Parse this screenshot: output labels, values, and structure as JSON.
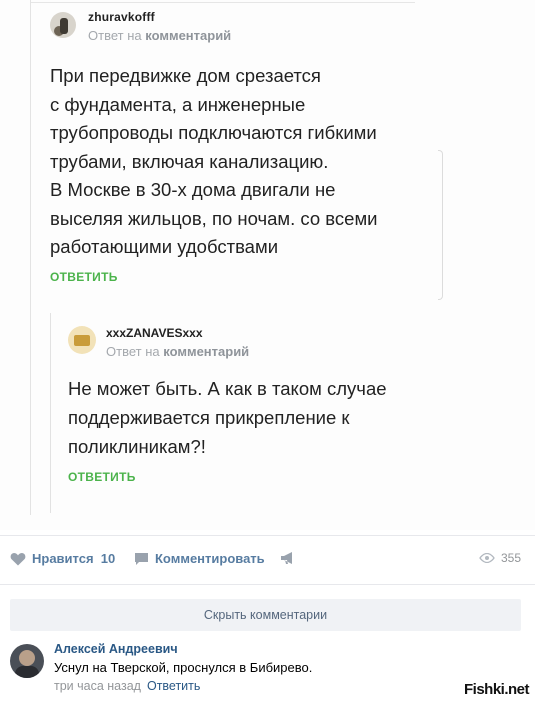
{
  "screenshot": {
    "comment1": {
      "author": "zhuravkofff",
      "reply_prefix": "Ответ на",
      "reply_target": "комментарий",
      "text_lines": [
        "При передвижке дом срезается",
        "с фундамента, а инженерные",
        "трубопроводы подключаются гибкими",
        "трубами, включая канализацию.",
        "В Москве в 30-х дома двигали не",
        "выселяя жильцов, по ночам. со всеми",
        "работающими удобствами"
      ],
      "reply_label": "ОТВЕТИТЬ"
    },
    "comment2": {
      "author": "xxxZANAVESxxx",
      "reply_prefix": "Ответ на",
      "reply_target": "комментарий",
      "text_lines": [
        "Не может быть. А как в таком случае",
        "поддерживается прикрепление к",
        "поликлиникам?!"
      ],
      "reply_label": "ОТВЕТИТЬ"
    }
  },
  "post_actions": {
    "like_label": "Нравится",
    "like_count": "10",
    "comment_label": "Комментировать",
    "views": "355"
  },
  "hide_comments_label": "Скрыть комментарии",
  "comment": {
    "author": "Алексей Андреевич",
    "text": "Уснул на Тверской, проснулся в Бибирево.",
    "time": "три часа назад",
    "reply_label": "Ответить"
  },
  "watermark": "Fishki.net",
  "colors": {
    "reply_green": "#4bb34b",
    "vk_link": "#2a5885",
    "action_blue": "#577ca1"
  },
  "icons": [
    "heart-icon",
    "comment-icon",
    "megaphone-icon",
    "eye-icon"
  ]
}
